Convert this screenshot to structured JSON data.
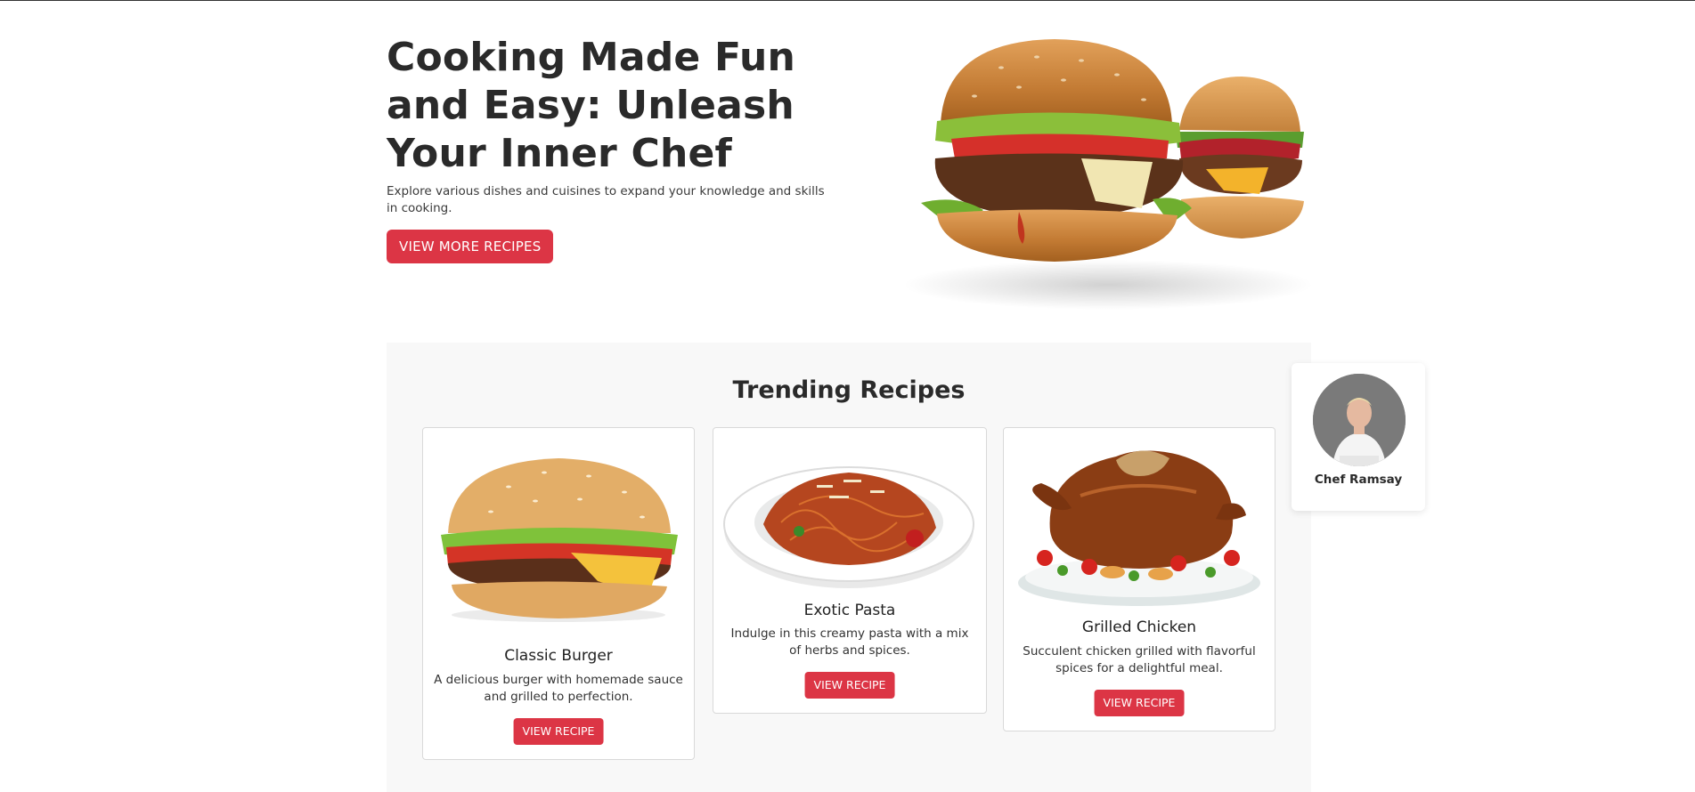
{
  "hero": {
    "title": "Cooking Made Fun and Easy: Unleash Your Inner Chef",
    "subtitle": "Explore various dishes and cuisines to expand your knowledge and skills in cooking.",
    "cta_label": "VIEW MORE RECIPES",
    "image": "burgers-illustration"
  },
  "trending": {
    "title": "Trending Recipes",
    "cards": [
      {
        "title": "Classic Burger",
        "description": "A delicious burger with homemade sauce and grilled to perfection.",
        "button": "VIEW RECIPE",
        "image": "burger-icon"
      },
      {
        "title": "Exotic Pasta",
        "description": "Indulge in this creamy pasta with a mix of herbs and spices.",
        "button": "VIEW RECIPE",
        "image": "pasta-icon"
      },
      {
        "title": "Grilled Chicken",
        "description": "Succulent chicken grilled with flavorful spices for a delightful meal.",
        "button": "VIEW RECIPE",
        "image": "chicken-icon"
      }
    ]
  },
  "chef": {
    "name": "Chef Ramsay",
    "avatar": "chef-avatar"
  },
  "colors": {
    "accent": "#dc3545",
    "section_bg": "#f8f8f8",
    "text": "#2b2b2b"
  }
}
